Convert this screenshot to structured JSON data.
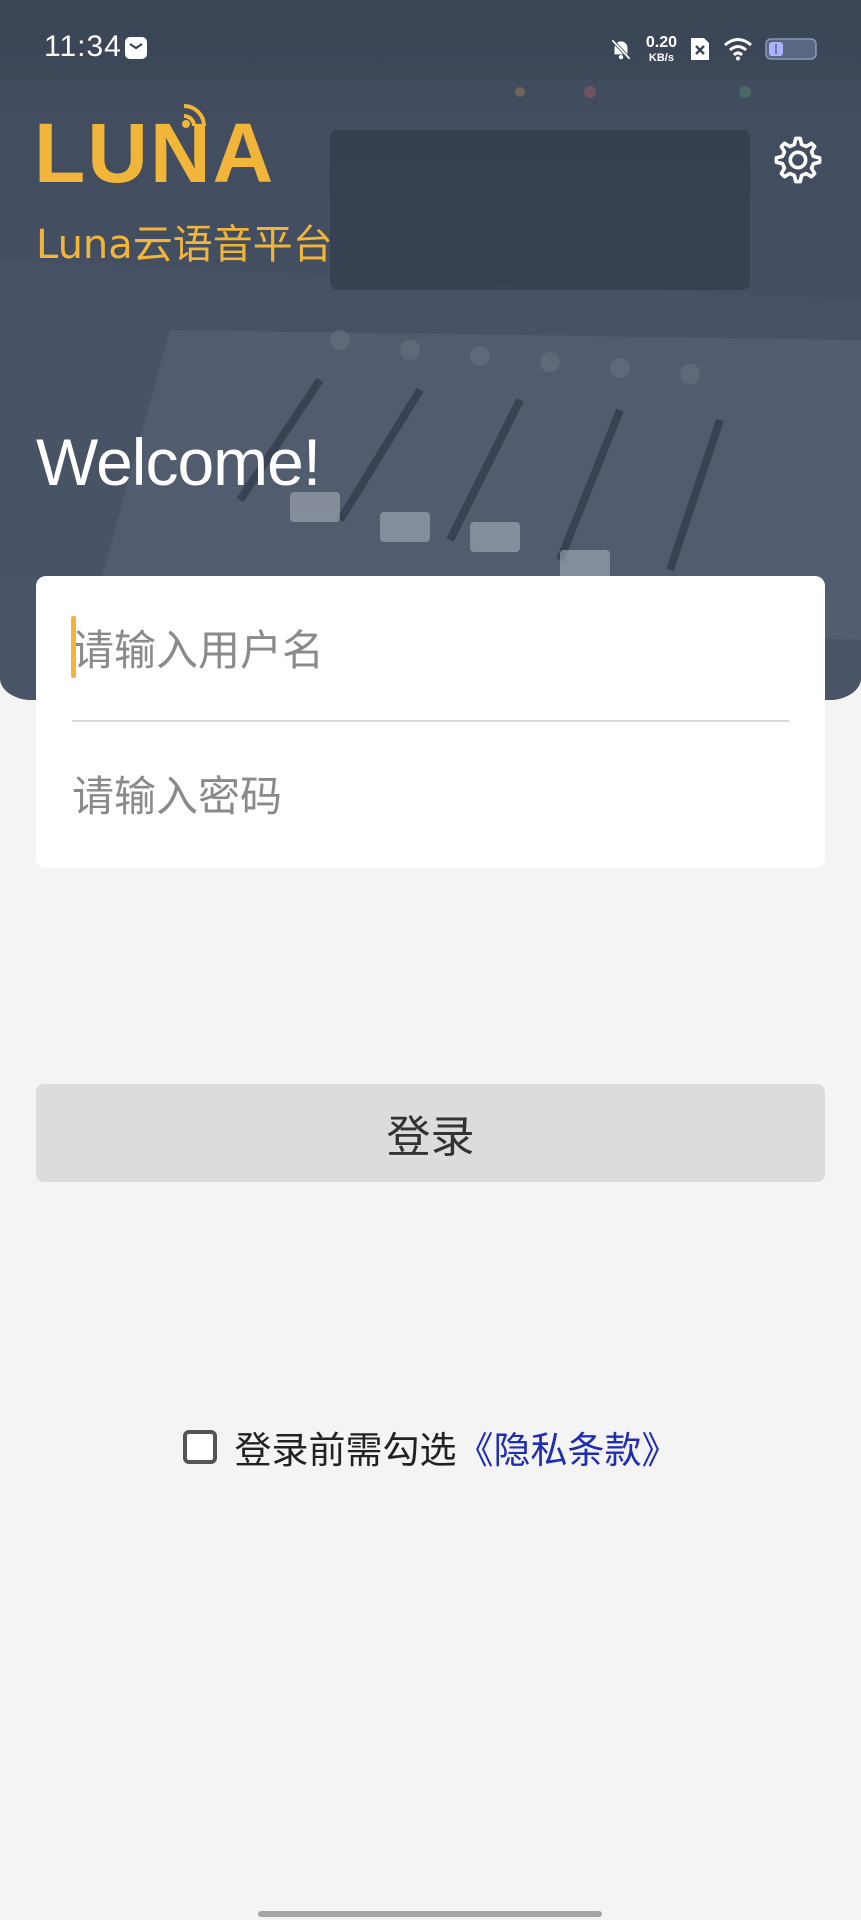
{
  "status_bar": {
    "time": "11:34",
    "net_speed_value": "0.20",
    "net_speed_unit": "KB/s",
    "icons": [
      "message-icon",
      "mute-bell-icon",
      "sim-off-icon",
      "wifi-icon",
      "battery-icon"
    ]
  },
  "header": {
    "logo_text": "LUNA",
    "subtitle": "Luna云语音平台",
    "settings_icon": "gear-icon",
    "brand_color": "#f1b53a"
  },
  "welcome_text": "Welcome!",
  "form": {
    "username_placeholder": "请输入用户名",
    "password_placeholder": "请输入密码",
    "login_label": "登录"
  },
  "agreement": {
    "text": "登录前需勾选",
    "link_text": "《隐私条款》",
    "link_color": "#1f2db3"
  }
}
